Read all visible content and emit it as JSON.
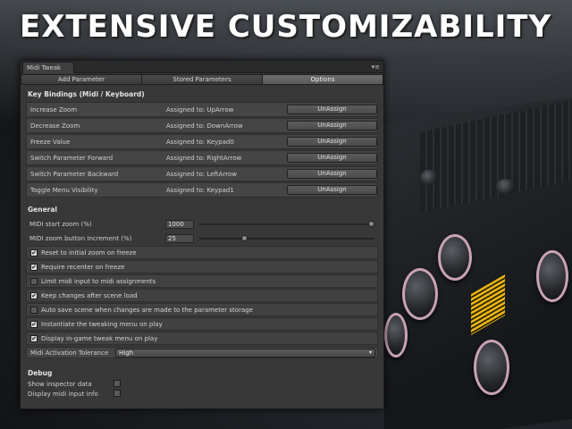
{
  "headline": "Extensive Customizability",
  "window": {
    "title": "Midi Tweak",
    "menu_icon": "▾≡"
  },
  "tabs": [
    {
      "label": "Add Parameter",
      "active": false
    },
    {
      "label": "Stored Parameters",
      "active": false
    },
    {
      "label": "Options",
      "active": true
    }
  ],
  "key_bindings": {
    "title": "Key Bindings (Midi / Keyboard)",
    "rows": [
      {
        "action": "Increase Zoom",
        "assigned": "Assigned to: UpArrow",
        "button": "UnAssign"
      },
      {
        "action": "Decrease Zoom",
        "assigned": "Assigned to: DownArrow",
        "button": "UnAssign"
      },
      {
        "action": "Freeze Value",
        "assigned": "Assigned to: Keypad0",
        "button": "UnAssign"
      },
      {
        "action": "Switch Parameter Forward",
        "assigned": "Assigned to: RightArrow",
        "button": "UnAssign"
      },
      {
        "action": "Switch Parameter Backward",
        "assigned": "Assigned to: LeftArrow",
        "button": "UnAssign"
      },
      {
        "action": "Toggle Menu Visibility",
        "assigned": "Assigned to: Keypad1",
        "button": "UnAssign"
      }
    ]
  },
  "general": {
    "title": "General",
    "start_zoom": {
      "label": "MIDI start zoom (%)",
      "value": "1000",
      "slider_fraction": 1.0
    },
    "zoom_increment": {
      "label": "MIDI zoom button Increment (%)",
      "value": "25",
      "slider_fraction": 0.25
    },
    "checks": [
      {
        "label": "Reset to initial zoom on freeze",
        "checked": true
      },
      {
        "label": "Require recenter on freeze",
        "checked": true
      },
      {
        "label": "Limit midi input to midi assignments",
        "checked": false
      },
      {
        "label": "Keep changes after scene load",
        "checked": true
      },
      {
        "label": "Auto save scene when changes are made to the parameter storage",
        "checked": false
      },
      {
        "label": "Instantiate the tweaking menu on play",
        "checked": true
      },
      {
        "label": "Display in-game tweak menu on play",
        "checked": true
      }
    ],
    "tolerance": {
      "label": "Midi Activation Tolerance",
      "value": "High"
    }
  },
  "debug": {
    "title": "Debug",
    "rows": [
      {
        "label": "Show inspector data",
        "checked": false
      },
      {
        "label": "Display midi input info",
        "checked": false
      }
    ]
  }
}
